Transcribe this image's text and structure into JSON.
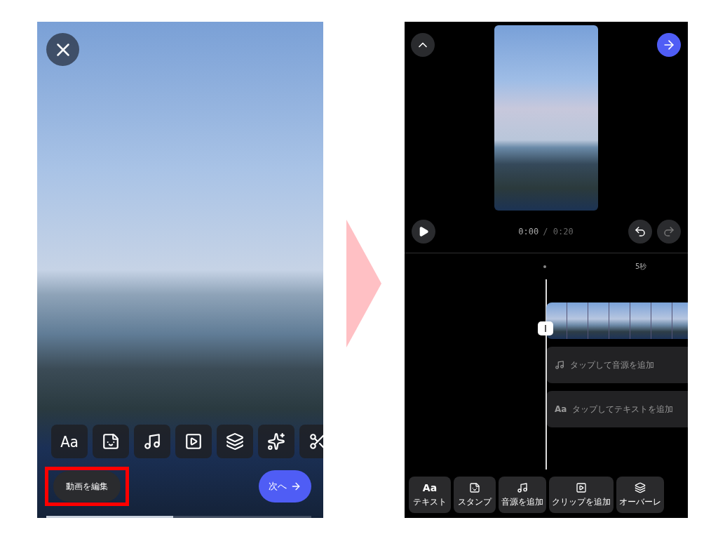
{
  "left_screen": {
    "tools": [
      {
        "kind": "text",
        "label": "Aa"
      },
      {
        "kind": "sticker"
      },
      {
        "kind": "music"
      },
      {
        "kind": "clip"
      },
      {
        "kind": "overlay"
      },
      {
        "kind": "effects"
      },
      {
        "kind": "cut"
      }
    ],
    "edit_button": {
      "label": "動画を編集",
      "highlighted": true
    },
    "next_button": {
      "label": "次へ"
    },
    "progress": {
      "level": 0.48
    }
  },
  "right_screen": {
    "current_time": "0:00",
    "duration": "/ 0:20",
    "undo": {
      "disabled": false
    },
    "redo": {
      "disabled": true
    },
    "ruler": {
      "label": "5秒"
    },
    "tracks": [
      {
        "kind": "music",
        "hint": "タップして音源を追加"
      },
      {
        "kind": "text",
        "icon_label": "Aa",
        "hint": "タップしてテキストを追加"
      }
    ],
    "toolbar": [
      {
        "kind": "text",
        "icon_label": "Aa",
        "label": "テキスト"
      },
      {
        "kind": "sticker",
        "label": "スタンプ"
      },
      {
        "kind": "music",
        "label": "音源を追加"
      },
      {
        "kind": "clip",
        "label": "クリップを追加"
      },
      {
        "kind": "overlay",
        "label": "オーバーレ"
      }
    ]
  }
}
